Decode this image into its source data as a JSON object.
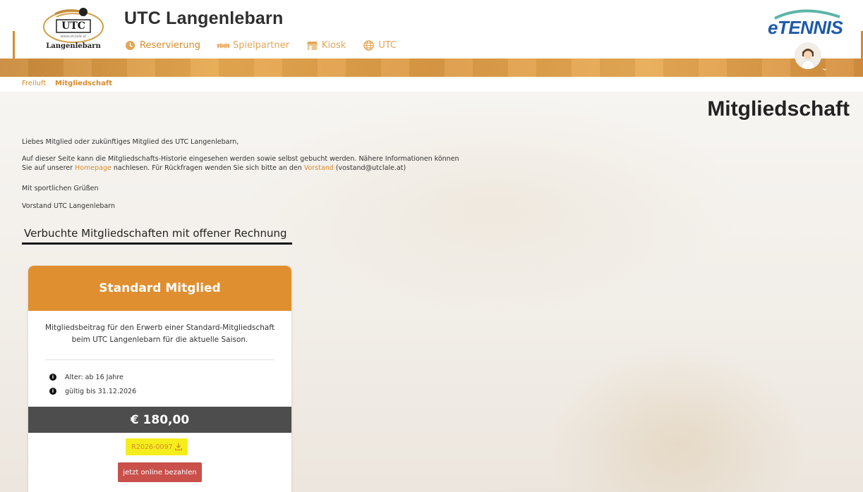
{
  "header": {
    "logo_text": "Langenlebarn",
    "logo_sub": "www.utclale.at",
    "logo_mark": "UTC",
    "title": "UTC Langenlebarn",
    "brand": "eTENNIS"
  },
  "nav": [
    {
      "label": "Reservierung",
      "icon": "clock-icon"
    },
    {
      "label": "Spielpartner",
      "icon": "handshake-icon"
    },
    {
      "label": "Kiosk",
      "icon": "kiosk-icon"
    },
    {
      "label": "UTC",
      "icon": "globe-icon"
    }
  ],
  "breadcrumb": [
    "Freiluft",
    "Mitgliedschaft"
  ],
  "page": {
    "title": "Mitgliedschaft",
    "greeting": "Liebes Mitglied oder zukünftiges Mitglied des UTC Langenlebarn,",
    "intro_part1": "Auf dieser Seite kann die Mitgliedschafts-Historie eingesehen werden sowie selbst gebucht werden. Nähere Informationen können Sie auf unserer ",
    "homepage_link": "Homepage",
    "intro_part2": " nachlesen. Für Rückfragen wenden Sie sich bitte an den ",
    "vorstand_link": "Vorstand",
    "intro_part3": " (vostand@utclale.at)",
    "regards": "Mit sportlichen Grüßen",
    "signature": "Vorstand UTC Langenlebarn",
    "section_heading": "Verbuchte Mitgliedschaften mit offener Rechnung"
  },
  "card": {
    "title": "Standard Mitglied",
    "description": "Mitgliedsbeitrag für den Erwerb einer Standard-Mitgliedschaft beim UTC Langenlebarn für die aktuelle Saison.",
    "info": [
      "Alter: ab 16 Jahre",
      "gültig bis 31.12.2026"
    ],
    "price": "€ 180,00",
    "invoice": "R2026-0097",
    "pay_button": "jetzt online bezahlen"
  },
  "colors": {
    "accent": "#d98b2b",
    "card_header": "#df8f2f",
    "price_bar": "#4d4d4d",
    "pay_button": "#c9504b",
    "highlight": "#f5ee1c",
    "brand_blue": "#1e5aa8"
  }
}
